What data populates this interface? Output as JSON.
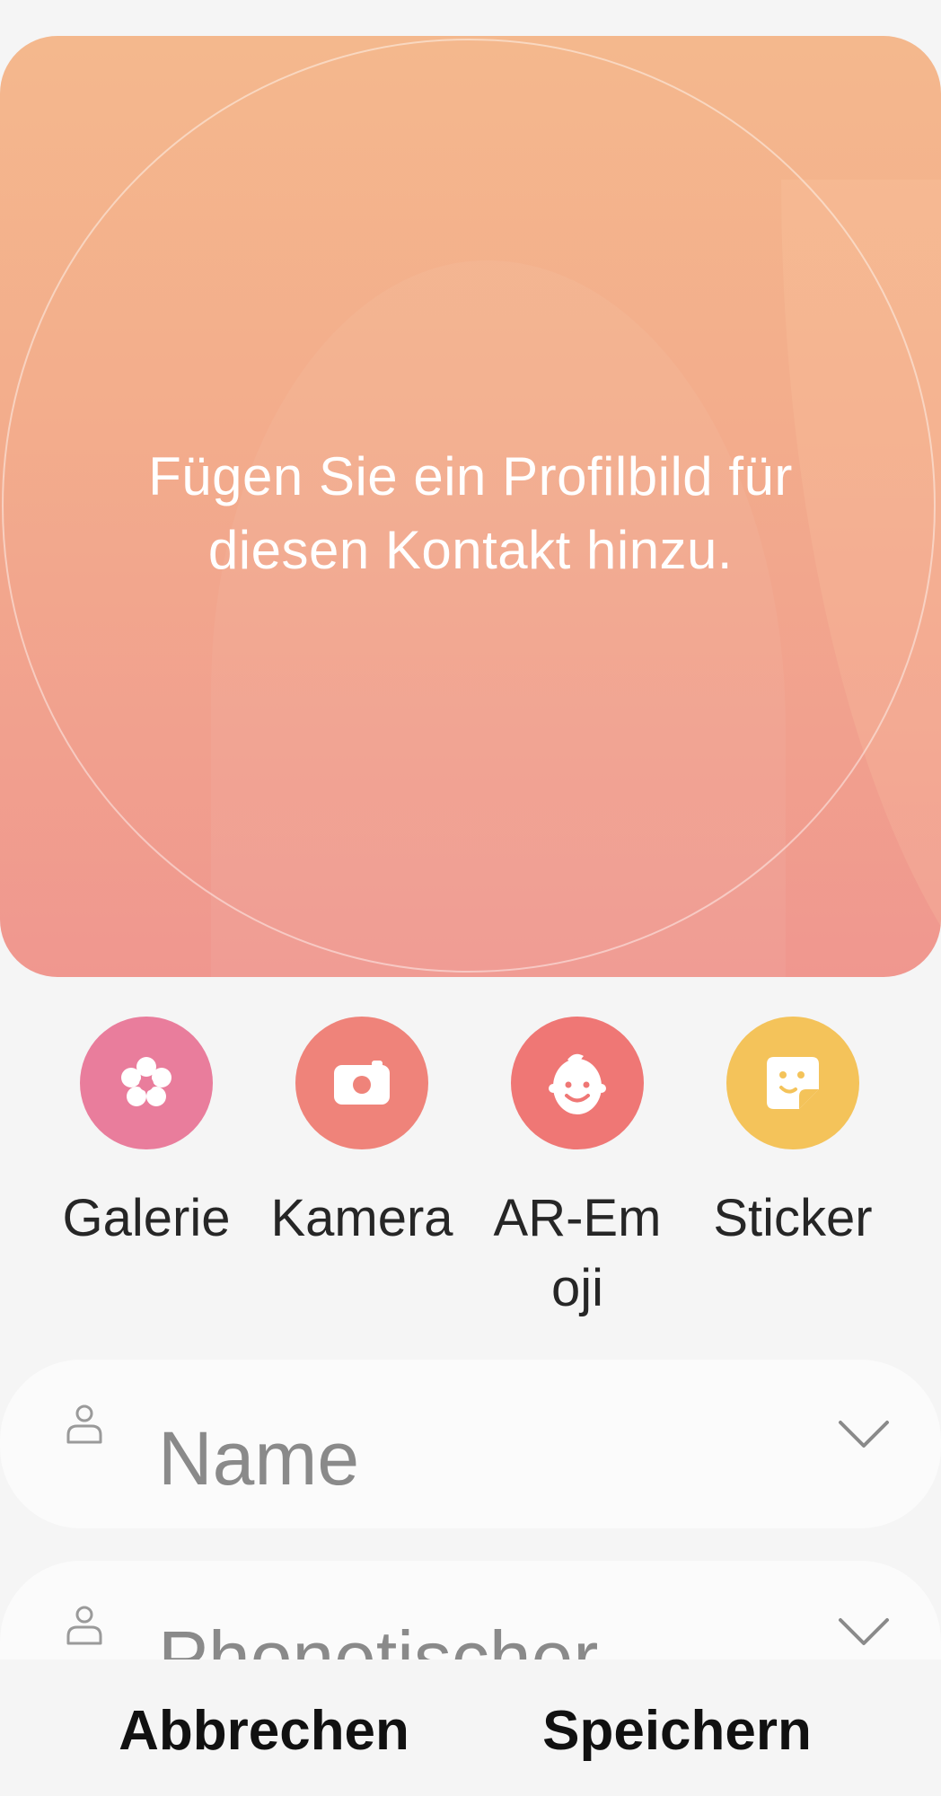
{
  "hero": {
    "hint": "Fügen Sie ein Profilbild für diesen Kontakt hinzu."
  },
  "options": [
    {
      "label": "Galerie",
      "icon": "flower-icon",
      "color": "#e97d9c"
    },
    {
      "label": "Kamera",
      "icon": "camera-icon",
      "color": "#ef837a"
    },
    {
      "label": "AR-Emoji",
      "icon": "face-icon",
      "color": "#ef7775"
    },
    {
      "label": "Sticker",
      "icon": "sticker-icon",
      "color": "#f4c35a"
    }
  ],
  "fields": {
    "name": {
      "placeholder": "Name",
      "icon": "person-icon"
    },
    "phonetic": {
      "placeholder": "Phonetischer",
      "icon": "person-icon"
    }
  },
  "actions": {
    "cancel": "Abbrechen",
    "save": "Speichern"
  },
  "colors": {
    "background": "#f5f5f5",
    "hero_top": "#f4b88d",
    "hero_bottom": "#f0978f"
  }
}
